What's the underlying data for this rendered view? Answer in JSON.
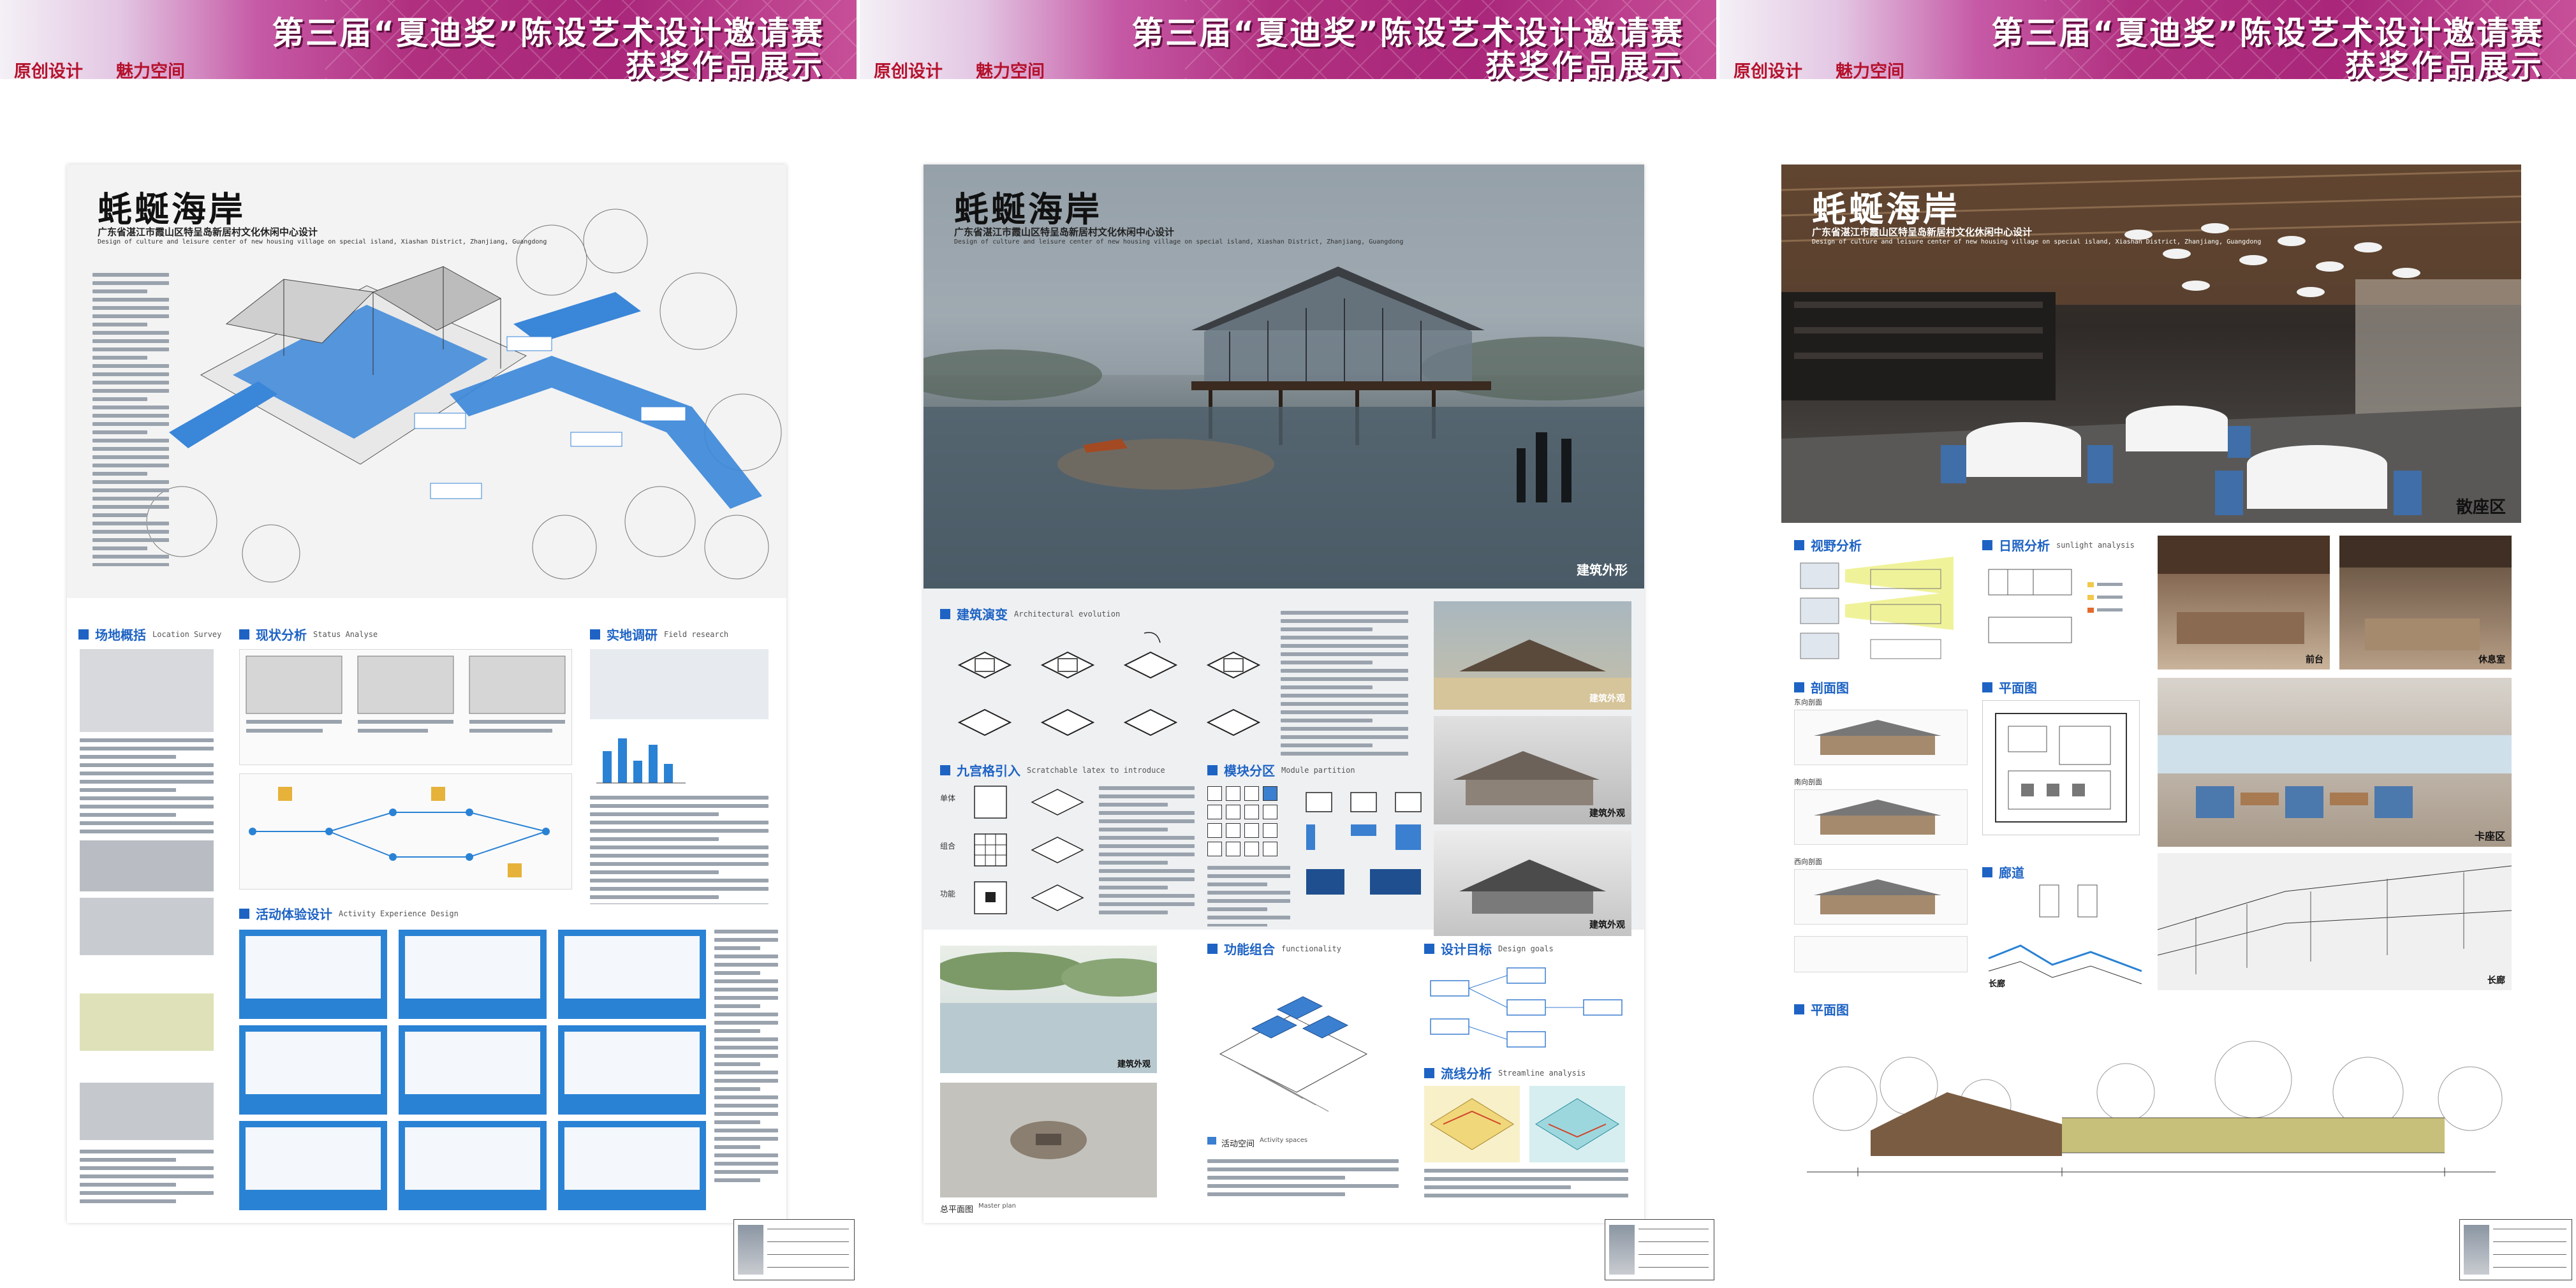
{
  "banner": {
    "title_line1": "第三届“夏迪奖”陈设艺术设计邀请赛",
    "title_line2": "获奖作品展示",
    "tag_original": "原创设计",
    "tag_space": "魅力空间"
  },
  "project": {
    "title": "蚝蜒海岸",
    "subtitle_cn": "广东省湛江市霞山区特呈岛新居村文化休闲中心设计",
    "subtitle_en": "Design of culture and leisure center of new housing village on special island, Xiashan District, Zhanjiang, Guangdong"
  },
  "panel1": {
    "sec_location": {
      "zh": "场地概括",
      "en": "Location Survey"
    },
    "sec_status": {
      "zh": "现状分析",
      "en": "Status Analyse"
    },
    "sec_field": {
      "zh": "实地调研",
      "en": "Field research"
    },
    "sec_activity": {
      "zh": "活动体验设计",
      "en": "Activity Experience Design"
    }
  },
  "panel2": {
    "hero_caption": "建筑外形",
    "sec_evolution": {
      "zh": "建筑演变",
      "en": "Architectural evolution"
    },
    "sec_ninegrid": {
      "zh": "九宫格引入",
      "en": "Scratchable latex to introduce"
    },
    "sec_module": {
      "zh": "模块分区",
      "en": "Module partition"
    },
    "sec_function": {
      "zh": "功能组合",
      "en": "functionality"
    },
    "sec_goals": {
      "zh": "设计目标",
      "en": "Design goals"
    },
    "sec_streamline": {
      "zh": "流线分析",
      "en": "Streamline analysis"
    },
    "side_cap1": "建筑外观",
    "side_cap2": "建筑外观",
    "side_cap3": "建筑外观",
    "aerial_cap": "建筑外观",
    "master_plan": "总平面图",
    "master_plan_en": "Master plan",
    "activity_space": "活动空间",
    "activity_space_en": "Activity spaces",
    "grid_labels": [
      "单体",
      "组合",
      "功能"
    ]
  },
  "panel3": {
    "hero_caption": "散座区",
    "sec_view": {
      "zh": "视野分析"
    },
    "sec_sun": {
      "zh": "日照分析",
      "en": "sunlight analysis"
    },
    "sec_elevation": {
      "zh": "剖面图"
    },
    "sec_plan": {
      "zh": "平面图"
    },
    "sec_corridor": {
      "zh": "廊道"
    },
    "sec_plan2": {
      "zh": "平面图"
    },
    "photo_cap1": "前台",
    "photo_cap2": "休息室",
    "photo_cap3": "卡座区",
    "corridor_cap1": "长廊",
    "corridor_cap2": "长廊",
    "elev_labels": [
      "东向剖面",
      "南向剖面",
      "西向剖面"
    ]
  },
  "colors": {
    "accent_blue": "#1e63c4",
    "banner_magenta": "#a9267a",
    "tag_red": "#b5122d"
  }
}
